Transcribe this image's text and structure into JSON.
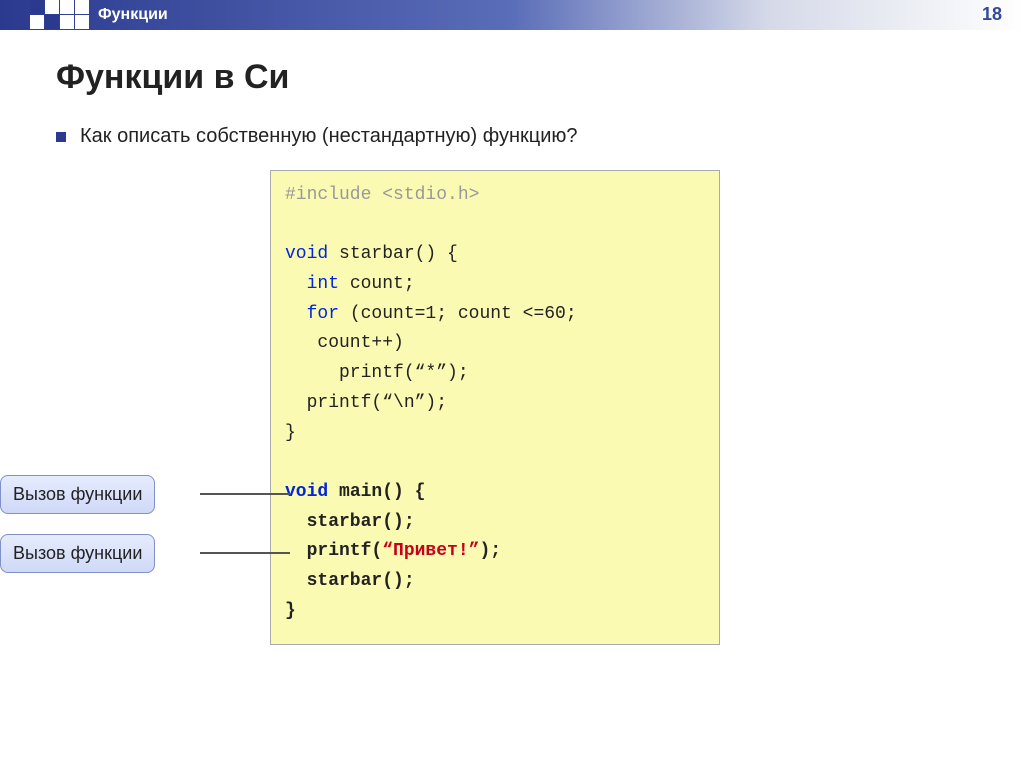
{
  "header": {
    "label": "Функции"
  },
  "page_number": "18",
  "title": "Функции в Си",
  "bullet": "Как описать собственную (нестандартную) функцию?",
  "code": {
    "l1a": "#include",
    "l1b": " <stdio.h>",
    "l2a": "void",
    "l2b": " starbar() {",
    "l3a": "  int",
    "l3b": " count;",
    "l4a": "  for",
    "l4b": " (count=1; count <=60;",
    "l5": "   count++)",
    "l6": "     printf(“*”);",
    "l7": "  printf(“\\n”);",
    "l8": "}",
    "l9a": "void",
    "l9b": " main() {",
    "l10": "  starbar();",
    "l11a": "  printf(",
    "l11b": "“Привет!”",
    "l11c": ");",
    "l12": "  starbar();",
    "l13": "}"
  },
  "callout1": "Вызов функции",
  "callout2": "Вызов функции"
}
